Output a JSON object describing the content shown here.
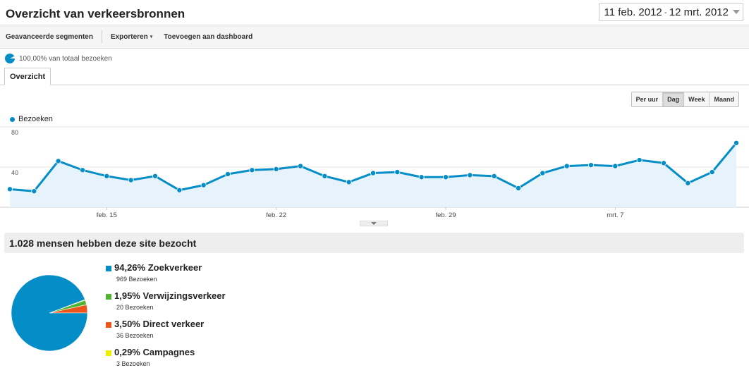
{
  "header": {
    "title": "Overzicht van verkeersbronnen",
    "date_start": "11 feb. 2012",
    "date_sep": "-",
    "date_end": "12 mrt. 2012"
  },
  "toolbar": {
    "segments_label": "Geavanceerde segmenten",
    "export_label": "Exporteren",
    "dashboard_label": "Toevoegen aan dashboard"
  },
  "segment": {
    "label": "100,00% van totaal bezoeken"
  },
  "tabs": [
    {
      "label": "Overzicht"
    }
  ],
  "granularity": {
    "options": [
      "Per uur",
      "Dag",
      "Week",
      "Maand"
    ],
    "active": "Dag"
  },
  "chart_data": {
    "type": "area",
    "series": [
      {
        "name": "Bezoeken",
        "color": "#058dc7",
        "values": [
          18,
          16,
          46,
          37,
          31,
          27,
          31,
          17,
          22,
          33,
          37,
          38,
          41,
          31,
          25,
          34,
          35,
          30,
          30,
          32,
          31,
          19,
          34,
          41,
          42,
          41,
          47,
          44,
          24,
          35,
          64
        ]
      }
    ],
    "x_tick_labels": [
      {
        "label": "feb. 15",
        "index": 4
      },
      {
        "label": "feb. 22",
        "index": 11
      },
      {
        "label": "feb. 29",
        "index": 18
      },
      {
        "label": "mrt. 7",
        "index": 25
      }
    ],
    "y_tick_labels": [
      "80",
      "40"
    ],
    "ylim": [
      0,
      80
    ],
    "grid": true
  },
  "summary": {
    "title": "1.028 mensen hebben deze site bezocht"
  },
  "sources": [
    {
      "pct": "94,26%",
      "name": "Zoekverkeer",
      "visits": "969 Bezoeken",
      "color": "#058dc7",
      "value": 94.26
    },
    {
      "pct": "1,95%",
      "name": "Verwijzingsverkeer",
      "visits": "20 Bezoeken",
      "color": "#50b432",
      "value": 1.95
    },
    {
      "pct": "3,50%",
      "name": "Direct verkeer",
      "visits": "36 Bezoeken",
      "color": "#ed561b",
      "value": 3.5
    },
    {
      "pct": "0,29%",
      "name": "Campagnes",
      "visits": "3 Bezoeken",
      "color": "#edef00",
      "value": 0.29
    }
  ]
}
